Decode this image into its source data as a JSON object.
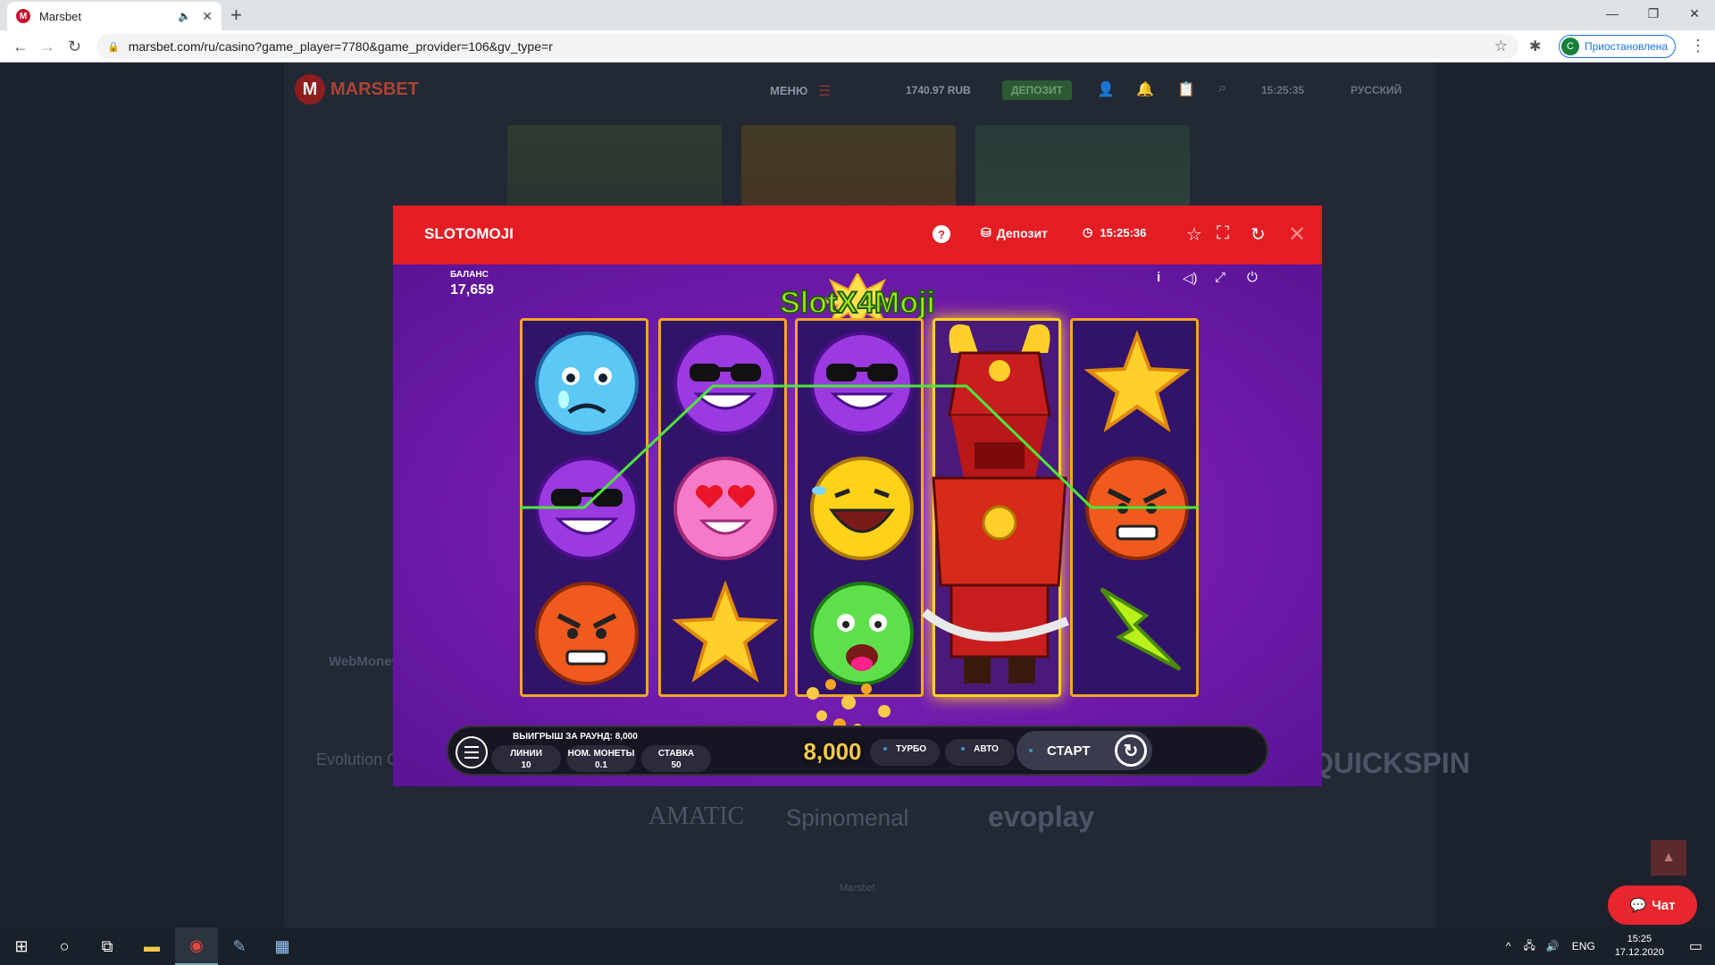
{
  "browser": {
    "tab_title": "Marsbet",
    "tab_favicon": "M",
    "url": "marsbet.com/ru/casino?game_player=7780&game_provider=106&gv_type=r",
    "profile_initial": "С",
    "profile_label": "Приостановлена"
  },
  "site": {
    "logo_text": "MARSBET",
    "menu_label": "МЕНЮ",
    "balance": "1740.97 RUB",
    "deposit_label": "ДЕПОЗИТ",
    "time": "15:25:35",
    "language": "РУССКИЙ",
    "footer_brand": "Marsbet",
    "providers": [
      "Evolution Gaming",
      "AMATIC",
      "Spinomenal",
      "evoplay",
      "QUICKSPIN",
      "WebMoney"
    ],
    "chat_label": "Чат"
  },
  "modal": {
    "title": "SLOTOMOJI",
    "deposit_label": "Депозит",
    "time": "15:25:36"
  },
  "game": {
    "balance_label": "БАЛАНС",
    "balance_value": "17,659",
    "logo": "SlotX4Moji",
    "round_win_label": "ВЫИГРЫШ ЗА РАУНД: 8,000",
    "lines_label": "ЛИНИИ",
    "lines_value": "10",
    "coin_label": "НОМ. МОНЕТЫ",
    "coin_value": "0.1",
    "bet_label": "СТАВКА",
    "bet_value": "50",
    "win_value": "8,000",
    "turbo_label": "ТУРБО",
    "auto_label": "АВТО",
    "spin_label": "СТАРТ",
    "reels": [
      [
        "sad-crying-emoji",
        "cool-sunglasses-emoji",
        "angry-emoji"
      ],
      [
        "cool-sunglasses-emoji",
        "heart-eyes-emoji",
        "star-symbol"
      ],
      [
        "cool-sunglasses-emoji",
        "laughing-tears-emoji",
        "sick-emoji"
      ],
      [
        "samurai-wild",
        "samurai-wild",
        "samurai-wild"
      ],
      [
        "star-symbol",
        "angry-emoji",
        "lightning-symbol"
      ]
    ],
    "colors": {
      "frame": "#f5a623",
      "bg": "#7a20bd",
      "header": "#e41d24"
    }
  },
  "taskbar": {
    "lang": "ENG",
    "time": "15:25",
    "date": "17.12.2020"
  }
}
